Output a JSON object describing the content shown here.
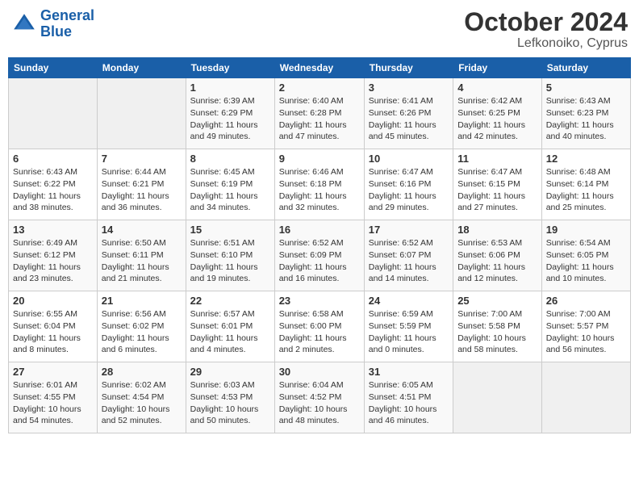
{
  "logo": {
    "line1": "General",
    "line2": "Blue"
  },
  "title": "October 2024",
  "location": "Lefkonoiko, Cyprus",
  "days_header": [
    "Sunday",
    "Monday",
    "Tuesday",
    "Wednesday",
    "Thursday",
    "Friday",
    "Saturday"
  ],
  "weeks": [
    [
      {
        "num": "",
        "info": ""
      },
      {
        "num": "",
        "info": ""
      },
      {
        "num": "1",
        "info": "Sunrise: 6:39 AM\nSunset: 6:29 PM\nDaylight: 11 hours and 49 minutes."
      },
      {
        "num": "2",
        "info": "Sunrise: 6:40 AM\nSunset: 6:28 PM\nDaylight: 11 hours and 47 minutes."
      },
      {
        "num": "3",
        "info": "Sunrise: 6:41 AM\nSunset: 6:26 PM\nDaylight: 11 hours and 45 minutes."
      },
      {
        "num": "4",
        "info": "Sunrise: 6:42 AM\nSunset: 6:25 PM\nDaylight: 11 hours and 42 minutes."
      },
      {
        "num": "5",
        "info": "Sunrise: 6:43 AM\nSunset: 6:23 PM\nDaylight: 11 hours and 40 minutes."
      }
    ],
    [
      {
        "num": "6",
        "info": "Sunrise: 6:43 AM\nSunset: 6:22 PM\nDaylight: 11 hours and 38 minutes."
      },
      {
        "num": "7",
        "info": "Sunrise: 6:44 AM\nSunset: 6:21 PM\nDaylight: 11 hours and 36 minutes."
      },
      {
        "num": "8",
        "info": "Sunrise: 6:45 AM\nSunset: 6:19 PM\nDaylight: 11 hours and 34 minutes."
      },
      {
        "num": "9",
        "info": "Sunrise: 6:46 AM\nSunset: 6:18 PM\nDaylight: 11 hours and 32 minutes."
      },
      {
        "num": "10",
        "info": "Sunrise: 6:47 AM\nSunset: 6:16 PM\nDaylight: 11 hours and 29 minutes."
      },
      {
        "num": "11",
        "info": "Sunrise: 6:47 AM\nSunset: 6:15 PM\nDaylight: 11 hours and 27 minutes."
      },
      {
        "num": "12",
        "info": "Sunrise: 6:48 AM\nSunset: 6:14 PM\nDaylight: 11 hours and 25 minutes."
      }
    ],
    [
      {
        "num": "13",
        "info": "Sunrise: 6:49 AM\nSunset: 6:12 PM\nDaylight: 11 hours and 23 minutes."
      },
      {
        "num": "14",
        "info": "Sunrise: 6:50 AM\nSunset: 6:11 PM\nDaylight: 11 hours and 21 minutes."
      },
      {
        "num": "15",
        "info": "Sunrise: 6:51 AM\nSunset: 6:10 PM\nDaylight: 11 hours and 19 minutes."
      },
      {
        "num": "16",
        "info": "Sunrise: 6:52 AM\nSunset: 6:09 PM\nDaylight: 11 hours and 16 minutes."
      },
      {
        "num": "17",
        "info": "Sunrise: 6:52 AM\nSunset: 6:07 PM\nDaylight: 11 hours and 14 minutes."
      },
      {
        "num": "18",
        "info": "Sunrise: 6:53 AM\nSunset: 6:06 PM\nDaylight: 11 hours and 12 minutes."
      },
      {
        "num": "19",
        "info": "Sunrise: 6:54 AM\nSunset: 6:05 PM\nDaylight: 11 hours and 10 minutes."
      }
    ],
    [
      {
        "num": "20",
        "info": "Sunrise: 6:55 AM\nSunset: 6:04 PM\nDaylight: 11 hours and 8 minutes."
      },
      {
        "num": "21",
        "info": "Sunrise: 6:56 AM\nSunset: 6:02 PM\nDaylight: 11 hours and 6 minutes."
      },
      {
        "num": "22",
        "info": "Sunrise: 6:57 AM\nSunset: 6:01 PM\nDaylight: 11 hours and 4 minutes."
      },
      {
        "num": "23",
        "info": "Sunrise: 6:58 AM\nSunset: 6:00 PM\nDaylight: 11 hours and 2 minutes."
      },
      {
        "num": "24",
        "info": "Sunrise: 6:59 AM\nSunset: 5:59 PM\nDaylight: 11 hours and 0 minutes."
      },
      {
        "num": "25",
        "info": "Sunrise: 7:00 AM\nSunset: 5:58 PM\nDaylight: 10 hours and 58 minutes."
      },
      {
        "num": "26",
        "info": "Sunrise: 7:00 AM\nSunset: 5:57 PM\nDaylight: 10 hours and 56 minutes."
      }
    ],
    [
      {
        "num": "27",
        "info": "Sunrise: 6:01 AM\nSunset: 4:55 PM\nDaylight: 10 hours and 54 minutes."
      },
      {
        "num": "28",
        "info": "Sunrise: 6:02 AM\nSunset: 4:54 PM\nDaylight: 10 hours and 52 minutes."
      },
      {
        "num": "29",
        "info": "Sunrise: 6:03 AM\nSunset: 4:53 PM\nDaylight: 10 hours and 50 minutes."
      },
      {
        "num": "30",
        "info": "Sunrise: 6:04 AM\nSunset: 4:52 PM\nDaylight: 10 hours and 48 minutes."
      },
      {
        "num": "31",
        "info": "Sunrise: 6:05 AM\nSunset: 4:51 PM\nDaylight: 10 hours and 46 minutes."
      },
      {
        "num": "",
        "info": ""
      },
      {
        "num": "",
        "info": ""
      }
    ]
  ]
}
